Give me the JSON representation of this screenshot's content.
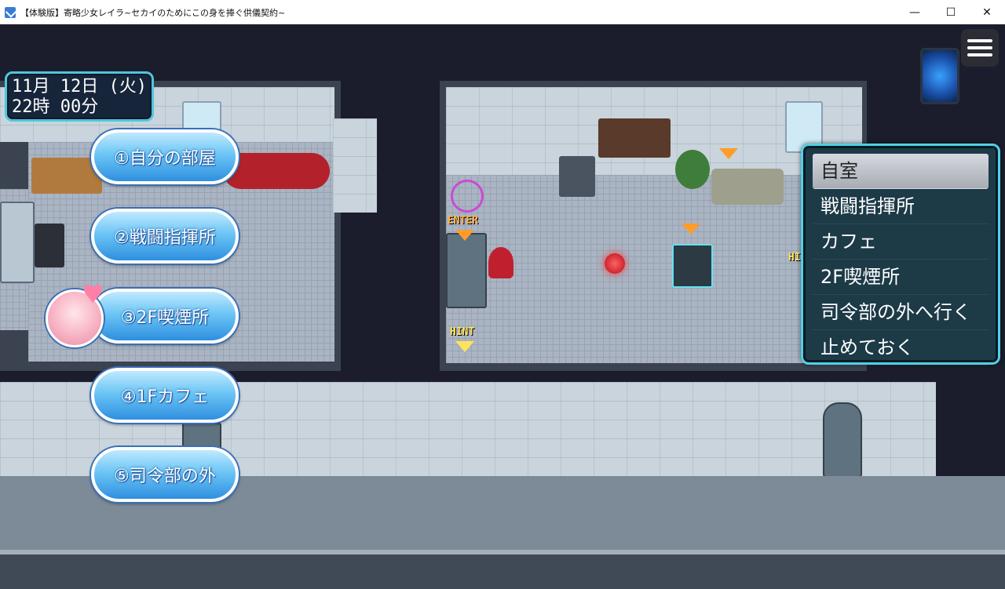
{
  "window": {
    "title": "【体験版】寄略少女レイラ~セカイのためにこの身を捧ぐ供儀契約~",
    "controls": [
      "—",
      "☐",
      "✕"
    ]
  },
  "hud": {
    "date": "11月 12日 (火)",
    "time": "22時 00分"
  },
  "shortcuts": [
    {
      "label": "①自分の部屋"
    },
    {
      "label": "②戦闘指揮所"
    },
    {
      "label": "③2F喫煙所"
    },
    {
      "label": "④1Fカフェ"
    },
    {
      "label": "⑤司令部の外"
    }
  ],
  "menu": {
    "items": [
      "自室",
      "戦闘指揮所",
      "カフェ",
      "2F喫煙所",
      "司令部の外へ行く",
      "止めておく"
    ],
    "selected_index": 0
  },
  "map_labels": {
    "enter": "ENTER",
    "hint": "HINT",
    "hint_partial": "HI"
  },
  "colors": {
    "menu_border": "#4fd0e6",
    "pill_blue": "#2f8fe0",
    "arrow_orange": "#ff9c2a",
    "hint_yellow": "#ffe35a"
  }
}
